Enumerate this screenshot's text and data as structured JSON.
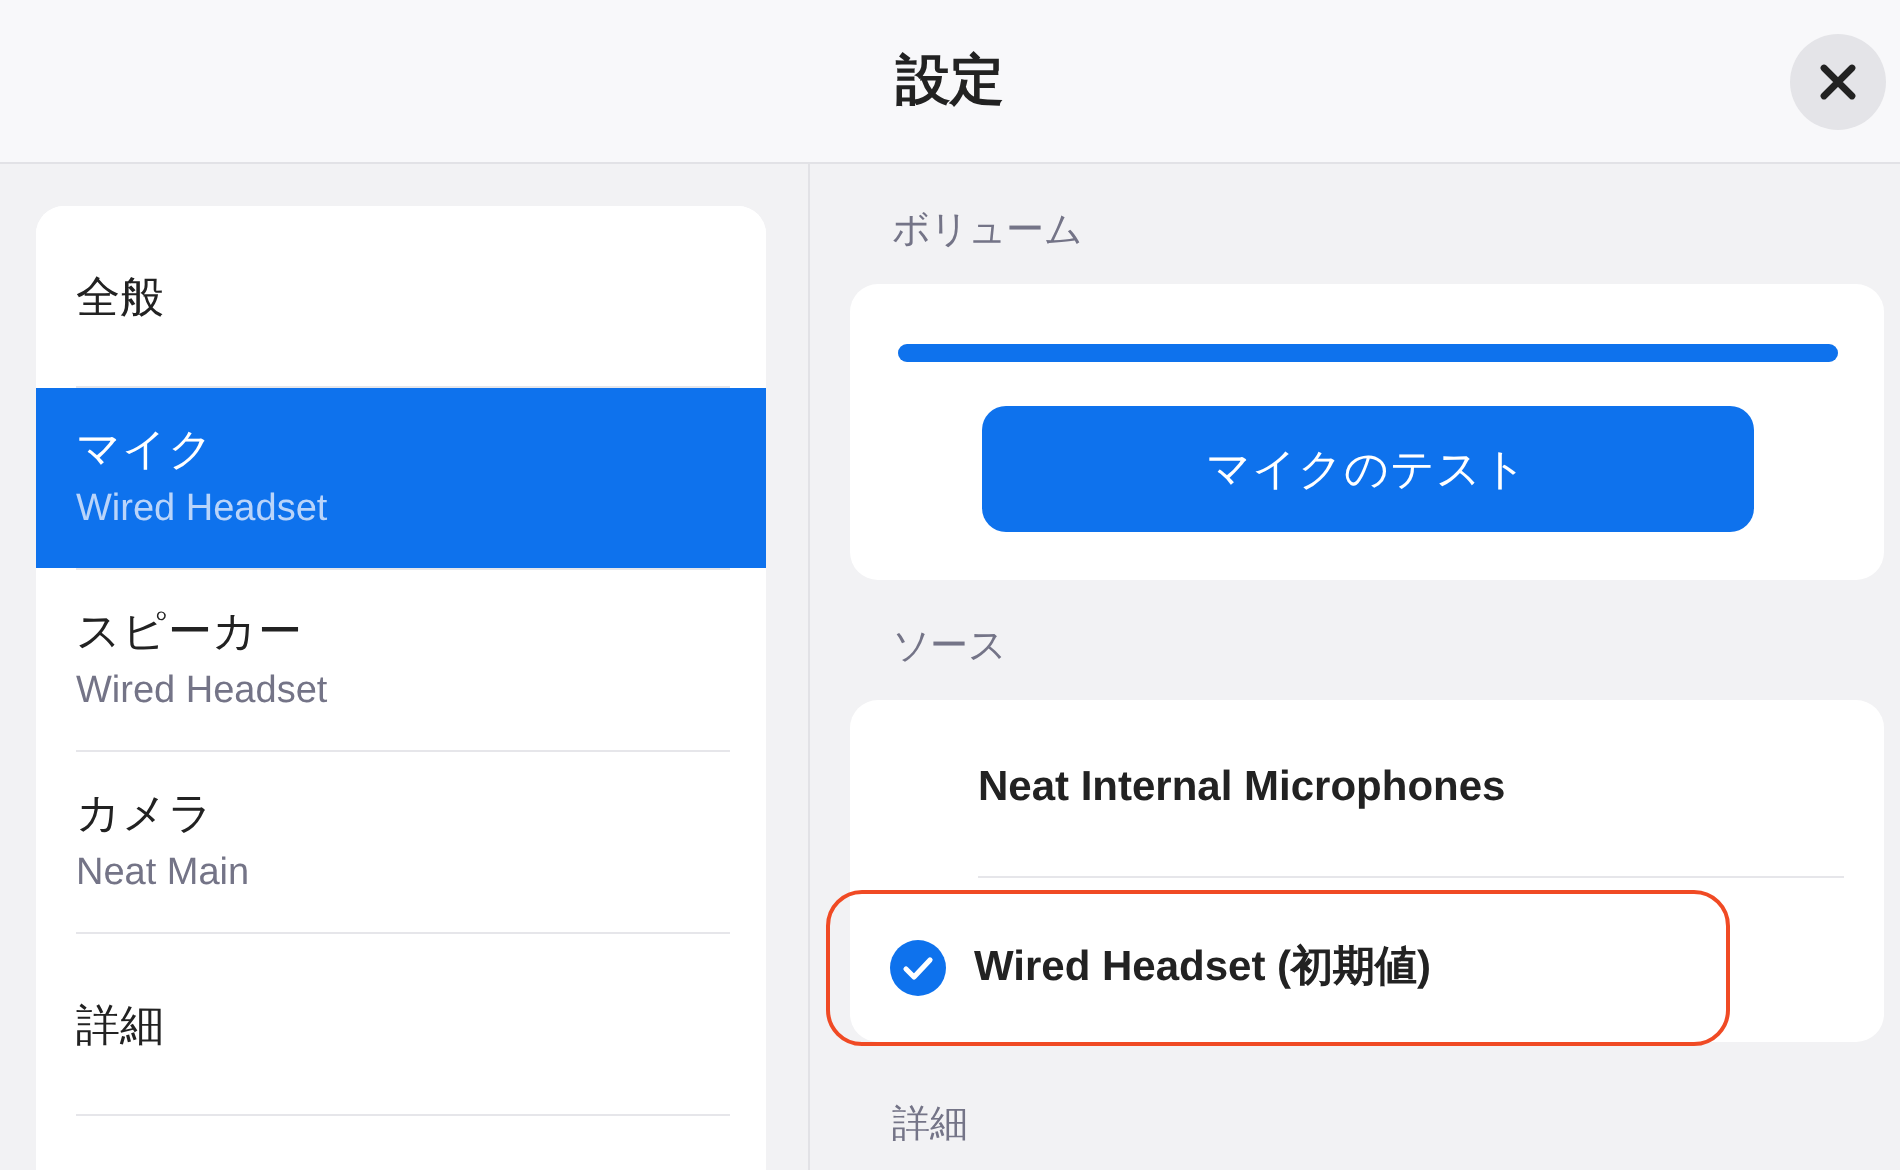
{
  "header": {
    "title": "設定"
  },
  "sidebar": {
    "items": [
      {
        "label": "全般",
        "selected": false
      },
      {
        "label": "マイク",
        "sublabel": "Wired Headset",
        "selected": true
      },
      {
        "label": "スピーカー",
        "sublabel": "Wired Headset",
        "selected": false
      },
      {
        "label": "カメラ",
        "sublabel": "Neat Main",
        "selected": false
      },
      {
        "label": "詳細",
        "selected": false
      }
    ]
  },
  "sections": [
    {
      "kind": "volume",
      "title": "ボリューム",
      "level": 1,
      "button": "マイクのテスト"
    },
    {
      "kind": "source",
      "title": "ソース",
      "options": [
        {
          "label": "Neat Internal Microphones",
          "selected": false,
          "highlighted": false
        },
        {
          "label": "Wired Headset (初期値)",
          "selected": true,
          "highlighted": true
        }
      ]
    },
    {
      "kind": "heading",
      "title": "詳細"
    }
  ]
}
